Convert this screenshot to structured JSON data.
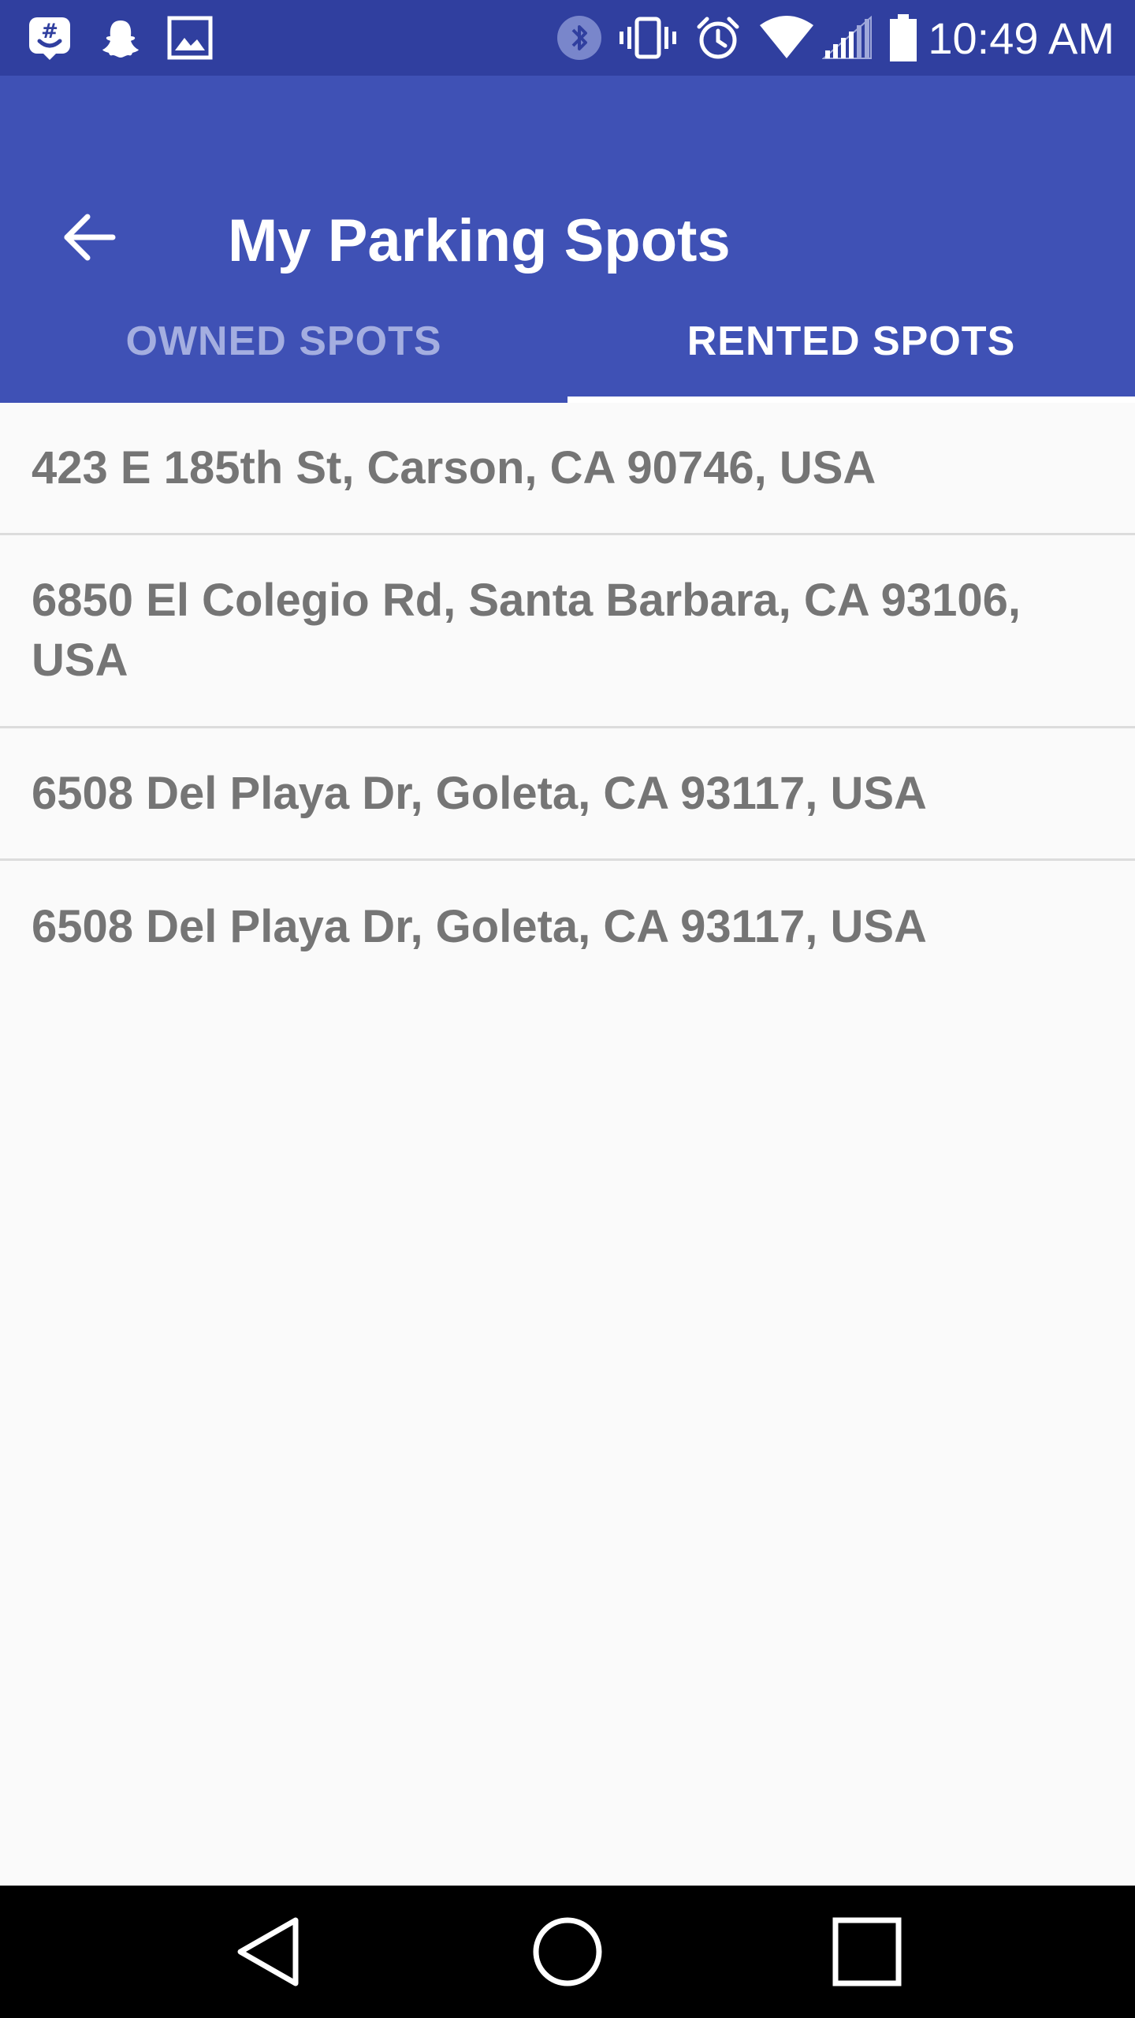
{
  "status_bar": {
    "time": "10:49 AM",
    "notification_icons": [
      "groupme-icon",
      "snapchat-icon",
      "gallery-icon"
    ],
    "system_icons": [
      "bluetooth-icon",
      "vibrate-icon",
      "alarm-icon",
      "wifi-icon",
      "signal-icon",
      "battery-icon"
    ]
  },
  "app_bar": {
    "title": "My Parking Spots",
    "back_icon": "arrow-back-icon"
  },
  "tabs": [
    {
      "label": "OWNED SPOTS",
      "active": false
    },
    {
      "label": "RENTED SPOTS",
      "active": true
    }
  ],
  "spots": [
    {
      "address": "423 E 185th St, Carson, CA 90746, USA"
    },
    {
      "address": "6850 El Colegio Rd, Santa Barbara, CA 93106, USA"
    },
    {
      "address": "6508 Del Playa Dr, Goleta, CA 93117, USA"
    },
    {
      "address": "6508 Del Playa Dr, Goleta, CA 93117, USA"
    }
  ],
  "nav_bar": {
    "buttons": [
      "back-triangle-icon",
      "home-circle-icon",
      "recents-square-icon"
    ]
  },
  "colors": {
    "status_bar": "#303f9f",
    "app_bar": "#3f51b5",
    "tab_inactive_text": "#a4aee0",
    "list_text": "#757575",
    "background": "#fafafa"
  }
}
